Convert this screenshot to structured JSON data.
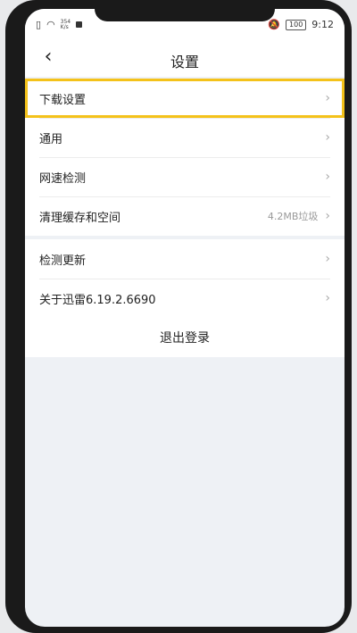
{
  "status_bar": {
    "network_speed": "354\nK/s",
    "battery": "100",
    "time": "9:12"
  },
  "header": {
    "title": "设置"
  },
  "group1": [
    {
      "label": "下载设置",
      "value": "",
      "highlight": true
    },
    {
      "label": "通用",
      "value": ""
    },
    {
      "label": "网速检测",
      "value": ""
    },
    {
      "label": "清理缓存和空间",
      "value": "4.2MB垃圾"
    }
  ],
  "group2": [
    {
      "label": "检测更新",
      "value": ""
    },
    {
      "label": "关于迅雷6.19.2.6690",
      "value": ""
    }
  ],
  "logout_label": "退出登录",
  "colors": {
    "highlight": "#f4c21a",
    "page_bg": "#eef1f5"
  }
}
